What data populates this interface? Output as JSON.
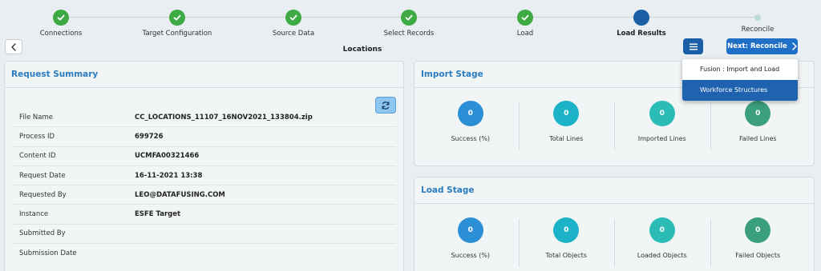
{
  "steps": [
    {
      "label": "Connections",
      "state": "done"
    },
    {
      "label": "Target Configuration",
      "state": "done"
    },
    {
      "label": "Source Data",
      "state": "done"
    },
    {
      "label": "Select Records",
      "state": "done"
    },
    {
      "label": "Load",
      "state": "done"
    },
    {
      "label": "Load Results",
      "state": "current"
    },
    {
      "label": "Reconcile",
      "state": "pending"
    }
  ],
  "header": {
    "title": "Locations",
    "next_label": "Next: Reconcile"
  },
  "menu": {
    "items": [
      "Fusion : Import and Load",
      "Workforce Structures"
    ],
    "active_index": 1
  },
  "summary": {
    "title": "Request Summary",
    "rows": [
      {
        "key": "File Name",
        "value": "CC_LOCATIONS_11107_16NOV2021_133804.zip"
      },
      {
        "key": "Process ID",
        "value": "699726"
      },
      {
        "key": "Content ID",
        "value": "UCMFA00321466"
      },
      {
        "key": "Request Date",
        "value": "16-11-2021 13:38"
      },
      {
        "key": "Requested By",
        "value": "LEO@DATAFUSING.COM"
      },
      {
        "key": "Instance",
        "value": "ESFE Target"
      },
      {
        "key": "Submitted By",
        "value": ""
      },
      {
        "key": "Submission Date",
        "value": ""
      }
    ]
  },
  "import_stage": {
    "title": "Import Stage",
    "metrics": [
      {
        "label": "Success (%)",
        "value": "0",
        "color": "#2b8fd6"
      },
      {
        "label": "Total Lines",
        "value": "0",
        "color": "#1cb3c8"
      },
      {
        "label": "Imported Lines",
        "value": "0",
        "color": "#2bbdb5"
      },
      {
        "label": "Failed Lines",
        "value": "0",
        "color": "#3b9e7c"
      }
    ]
  },
  "load_stage": {
    "title": "Load Stage",
    "metrics": [
      {
        "label": "Success (%)",
        "value": "0",
        "color": "#2b8fd6"
      },
      {
        "label": "Total Objects",
        "value": "0",
        "color": "#1cb3c8"
      },
      {
        "label": "Loaded Objects",
        "value": "0",
        "color": "#2bbdb5"
      },
      {
        "label": "Failed Objects",
        "value": "0",
        "color": "#3b9e7c"
      }
    ]
  },
  "icons": {
    "check": "check-icon",
    "back": "chevron-left-icon",
    "menu": "list-icon",
    "next": "chevron-right-icon",
    "refresh": "refresh-icon"
  }
}
